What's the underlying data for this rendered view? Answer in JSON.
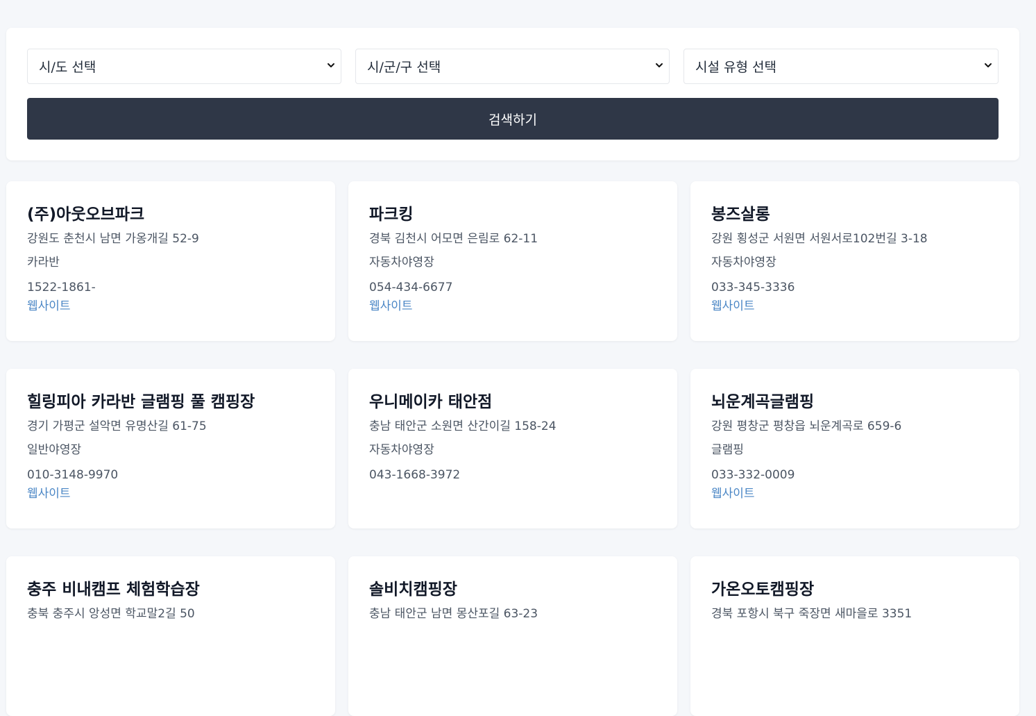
{
  "filters": {
    "province": "시/도 선택",
    "district": "시/군/구 선택",
    "facility_type": "시설 유형 선택"
  },
  "search_button": "검색하기",
  "colors": {
    "button_bg": "#2f3747",
    "link": "#4a86c5",
    "page_bg": "#f5f7fa"
  },
  "icons": {
    "dropdown": "chevron-down-icon"
  },
  "cards": [
    {
      "name": "(주)아웃오브파크",
      "address": "강원도 춘천시 남면 가옹개길 52-9",
      "type": "카라반",
      "phone": "1522-1861-",
      "website": "웹사이트"
    },
    {
      "name": "파크킹",
      "address": "경북 김천시 어모면 은림로 62-11",
      "type": "자동차야영장",
      "phone": "054-434-6677",
      "website": "웹사이트"
    },
    {
      "name": "봉즈살롱",
      "address": "강원 횡성군 서원면 서원서로102번길 3-18",
      "type": "자동차야영장",
      "phone": "033-345-3336",
      "website": "웹사이트"
    },
    {
      "name": "힐링피아 카라반 글램핑 풀 캠핑장",
      "address": "경기 가평군 설악면 유명산길 61-75",
      "type": "일반야영장",
      "phone": "010-3148-9970",
      "website": "웹사이트"
    },
    {
      "name": "우니메이카 태안점",
      "address": "충남 태안군 소원면 산간이길 158-24",
      "type": "자동차야영장",
      "phone": "043-1668-3972",
      "website": ""
    },
    {
      "name": "뇌운계곡글램핑",
      "address": "강원 평창군 평창읍 뇌운계곡로 659-6",
      "type": "글램핑",
      "phone": "033-332-0009",
      "website": "웹사이트"
    },
    {
      "name": "충주 비내캠프 체험학습장",
      "address": "충북 충주시 앙성면 학교말2길 50",
      "type": "",
      "phone": "",
      "website": ""
    },
    {
      "name": "솔비치캠핑장",
      "address": "충남 태안군 남면 몽산포길 63-23",
      "type": "",
      "phone": "",
      "website": ""
    },
    {
      "name": "가온오토캠핑장",
      "address": "경북 포항시 북구 죽장면 새마을로 3351",
      "type": "",
      "phone": "",
      "website": ""
    }
  ]
}
